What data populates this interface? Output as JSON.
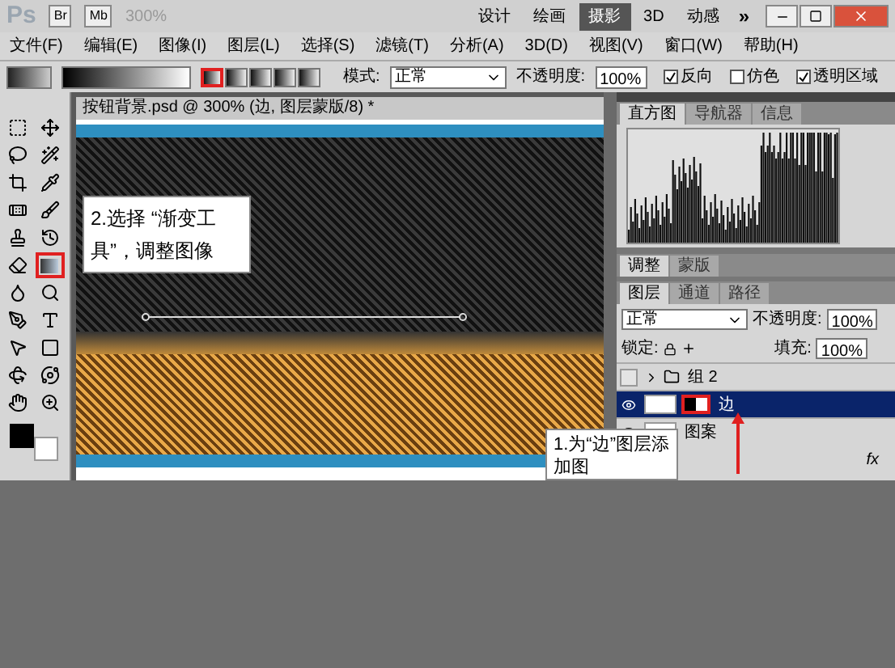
{
  "app_bar": {
    "logo": "Ps",
    "bridge": "Br",
    "mini_bridge": "Mb",
    "zoom": "300%",
    "workspaces": [
      {
        "label": "设计",
        "selected": false
      },
      {
        "label": "绘画",
        "selected": false
      },
      {
        "label": "摄影",
        "selected": true
      },
      {
        "label": "3D",
        "selected": false
      },
      {
        "label": "动感",
        "selected": false
      }
    ],
    "more": "»"
  },
  "menu": [
    "文件(F)",
    "编辑(E)",
    "图像(I)",
    "图层(L)",
    "选择(S)",
    "滤镜(T)",
    "分析(A)",
    "3D(D)",
    "视图(V)",
    "窗口(W)",
    "帮助(H)"
  ],
  "options": {
    "mode_label": "模式:",
    "mode": "正常",
    "opacity_label": "不透明度:",
    "opacity": "100%",
    "checks": [
      {
        "label": "反向",
        "checked": true
      },
      {
        "label": "仿色",
        "checked": false
      },
      {
        "label": "透明区域",
        "checked": true
      }
    ],
    "gradient_types": [
      {
        "selected": true
      },
      {
        "selected": false
      },
      {
        "selected": false
      },
      {
        "selected": false
      },
      {
        "selected": false
      }
    ]
  },
  "tools": [
    {
      "kind": "marquee",
      "selected": false
    },
    {
      "kind": "move",
      "selected": false
    },
    {
      "kind": "lasso",
      "selected": false
    },
    {
      "kind": "wand",
      "selected": false
    },
    {
      "kind": "crop",
      "selected": false
    },
    {
      "kind": "eyedropper",
      "selected": false
    },
    {
      "kind": "heal",
      "selected": false
    },
    {
      "kind": "brush",
      "selected": false
    },
    {
      "kind": "stamp",
      "selected": false
    },
    {
      "kind": "history",
      "selected": false
    },
    {
      "kind": "eraser",
      "selected": false
    },
    {
      "kind": "gradient",
      "selected": true
    },
    {
      "kind": "blur",
      "selected": false
    },
    {
      "kind": "dodge",
      "selected": false
    },
    {
      "kind": "pen",
      "selected": false
    },
    {
      "kind": "type",
      "selected": false
    },
    {
      "kind": "select",
      "selected": false
    },
    {
      "kind": "shape",
      "selected": false
    },
    {
      "kind": "rotate3d",
      "selected": false
    },
    {
      "kind": "orbit3d",
      "selected": false
    },
    {
      "kind": "hand",
      "selected": false
    },
    {
      "kind": "zoom",
      "selected": false
    }
  ],
  "document": {
    "title": "按钮背景.psd @ 300% (边, 图层蒙版/8) *"
  },
  "callouts": [
    {
      "text": "2.选择 “渐变工具”，调整图像"
    },
    {
      "lines": [
        "1.为“边”图层添",
        "加图"
      ]
    }
  ],
  "histogram_panel": {
    "tabs": [
      {
        "label": "直方图",
        "selected": true
      },
      {
        "label": "导航器",
        "selected": false
      },
      {
        "label": "信息",
        "selected": false
      }
    ]
  },
  "adjust_panel": {
    "tabs": [
      {
        "label": "调整",
        "selected": true
      },
      {
        "label": "蒙版",
        "selected": false
      }
    ]
  },
  "layers_panel": {
    "tabs": [
      {
        "label": "图层",
        "selected": true
      },
      {
        "label": "通道",
        "selected": false
      },
      {
        "label": "路径",
        "selected": false
      }
    ],
    "blend": "正常",
    "opacity_label": "不透明度:",
    "opacity": "100%",
    "lock_label": "锁定:",
    "fill_label": "填充:",
    "fill": "100%",
    "layers": [
      {
        "kind": "group",
        "name": "组 2",
        "visible": false,
        "selected": false
      },
      {
        "kind": "masked",
        "name": "边",
        "visible": true,
        "selected": true
      },
      {
        "kind": "layer",
        "name": "图案",
        "visible": true,
        "selected": false
      }
    ],
    "fx": "fx"
  }
}
